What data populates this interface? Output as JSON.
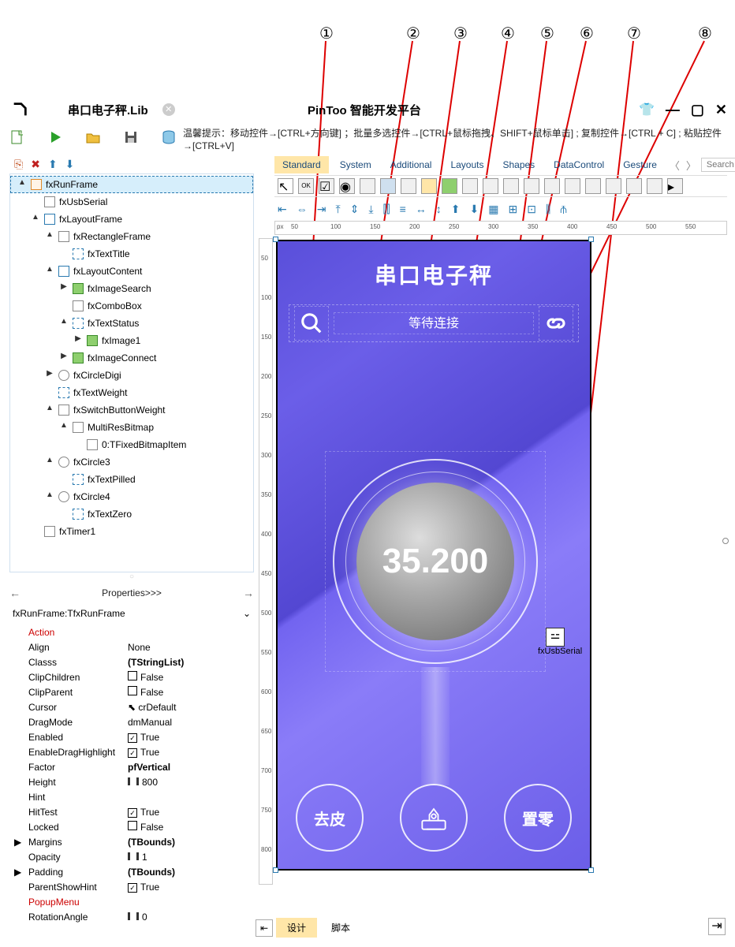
{
  "annotations": [
    "①",
    "②",
    "③",
    "④",
    "⑤",
    "⑥",
    "⑦",
    "⑧"
  ],
  "titlebar": {
    "filename": "串口电子秤.Lib",
    "app_title": "PinToo 智能开发平台"
  },
  "hint": "温馨提示：移动控件→[CTRL+方向键] ；批量多选控件→[CTRL+鼠标拖拽、SHIFT+鼠标单击] ; 复制控件→[CTRL + C] ; 粘贴控件→[CTRL+V]",
  "tabs": {
    "items": [
      "Standard",
      "System",
      "Additional",
      "Layouts",
      "Shapes",
      "DataControl",
      "Gesture"
    ],
    "search_ph": "Search"
  },
  "ruler_h": [
    "50",
    "100",
    "150",
    "200",
    "250",
    "300",
    "350",
    "400",
    "450",
    "500",
    "550"
  ],
  "ruler_v": [
    "50",
    "100",
    "150",
    "200",
    "250",
    "300",
    "350",
    "400",
    "450",
    "500",
    "550",
    "600",
    "650",
    "700",
    "750",
    "800"
  ],
  "tree": [
    {
      "d": 0,
      "t": "fxRunFrame",
      "sel": true,
      "ico": "frame",
      "exp": "▲"
    },
    {
      "d": 1,
      "t": "fxUsbSerial",
      "ico": "usb"
    },
    {
      "d": 1,
      "t": "fxLayoutFrame",
      "ico": "layout",
      "exp": "▲"
    },
    {
      "d": 2,
      "t": "fxRectangleFrame",
      "ico": "rect",
      "exp": "▲"
    },
    {
      "d": 3,
      "t": "fxTextTitle",
      "ico": "txt"
    },
    {
      "d": 2,
      "t": "fxLayoutContent",
      "ico": "layout",
      "exp": "▲"
    },
    {
      "d": 3,
      "t": "fxImageSearch",
      "ico": "img",
      "exp": "▶"
    },
    {
      "d": 3,
      "t": "fxComboBox",
      "ico": "combo"
    },
    {
      "d": 3,
      "t": "fxTextStatus",
      "ico": "txt",
      "exp": "▲"
    },
    {
      "d": 4,
      "t": "fxImage1",
      "ico": "img",
      "exp": "▶"
    },
    {
      "d": 3,
      "t": "fxImageConnect",
      "ico": "img",
      "exp": "▶"
    },
    {
      "d": 2,
      "t": "fxCircleDigi",
      "ico": "circ",
      "exp": "▶"
    },
    {
      "d": 2,
      "t": "fxTextWeight",
      "ico": "txt"
    },
    {
      "d": 2,
      "t": "fxSwitchButtonWeight",
      "ico": "switch",
      "exp": "▲"
    },
    {
      "d": 3,
      "t": "MultiResBitmap",
      "ico": "bmp",
      "exp": "▲"
    },
    {
      "d": 4,
      "t": "0:TFixedBitmapItem",
      "ico": "pin"
    },
    {
      "d": 2,
      "t": "fxCircle3",
      "ico": "circ",
      "exp": "▲"
    },
    {
      "d": 3,
      "t": "fxTextPilled",
      "ico": "txt"
    },
    {
      "d": 2,
      "t": "fxCircle4",
      "ico": "circ",
      "exp": "▲"
    },
    {
      "d": 3,
      "t": "fxTextZero",
      "ico": "txt"
    },
    {
      "d": 1,
      "t": "fxTimer1",
      "ico": "timer"
    }
  ],
  "splitter": "Properties>>>",
  "prop_header": "fxRunFrame:TfxRunFrame",
  "props": [
    {
      "n": "Action",
      "red": true
    },
    {
      "n": "Align",
      "v": "None"
    },
    {
      "n": "Classs",
      "v": "(TStringList)",
      "b": true
    },
    {
      "n": "ClipChildren",
      "v": "False",
      "chk": false
    },
    {
      "n": "ClipParent",
      "v": "False",
      "chk": false
    },
    {
      "n": "Cursor",
      "v": "crDefault",
      "ico": "cur"
    },
    {
      "n": "DragMode",
      "v": "dmManual"
    },
    {
      "n": "Enabled",
      "v": "True",
      "chk": true
    },
    {
      "n": "EnableDragHighlight",
      "v": "True",
      "chk": true
    },
    {
      "n": "Factor",
      "v": "pfVertical",
      "b": true
    },
    {
      "n": "Height",
      "v": "800",
      "ico": "size"
    },
    {
      "n": "Hint",
      "v": ""
    },
    {
      "n": "HitTest",
      "v": "True",
      "chk": true
    },
    {
      "n": "Locked",
      "v": "False",
      "chk": false
    },
    {
      "n": "Margins",
      "v": "(TBounds)",
      "b": true,
      "arrow": true
    },
    {
      "n": "Opacity",
      "v": "1",
      "ico": "size"
    },
    {
      "n": "Padding",
      "v": "(TBounds)",
      "b": true,
      "arrow": true
    },
    {
      "n": "ParentShowHint",
      "v": "True",
      "chk": true
    },
    {
      "n": "PopupMenu",
      "red": true
    },
    {
      "n": "RotationAngle",
      "v": "0",
      "ico": "size"
    }
  ],
  "phone": {
    "title": "串口电子秤",
    "status": "等待连接",
    "weight": "35.200",
    "usb": "fxUsbSerial",
    "btn_tare": "去皮",
    "btn_zero": "置零"
  },
  "bottom": {
    "design": "设计",
    "script": "脚本"
  },
  "chart_data": {
    "type": "table",
    "note": "screenshot is an IDE designer, not a chart"
  }
}
